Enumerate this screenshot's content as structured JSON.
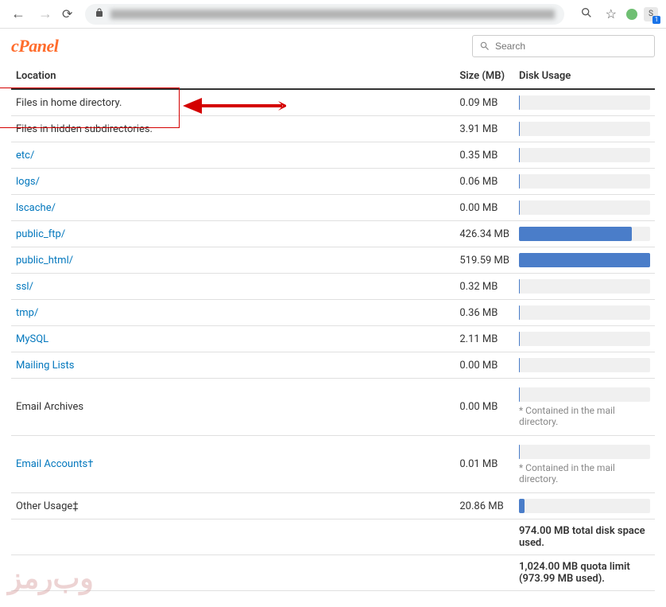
{
  "browser": {
    "ext_letter": "S"
  },
  "logo_text": "cPanel",
  "search": {
    "placeholder": "Search"
  },
  "table": {
    "headers": {
      "location": "Location",
      "size": "Size (MB)",
      "usage": "Disk Usage"
    },
    "rows": [
      {
        "label": "Files in home directory.",
        "link": false,
        "size": "0.09 MB",
        "bar": 0.5,
        "note": null
      },
      {
        "label": "Files in hidden subdirectories.",
        "link": false,
        "size": "3.91 MB",
        "bar": 0.5,
        "note": null
      },
      {
        "label": "etc/",
        "link": true,
        "size": "0.35 MB",
        "bar": 0.5,
        "note": null
      },
      {
        "label": "logs/",
        "link": true,
        "size": "0.06 MB",
        "bar": 0.5,
        "note": null
      },
      {
        "label": "lscache/",
        "link": true,
        "size": "0.00 MB",
        "bar": 0.5,
        "note": null
      },
      {
        "label": "public_ftp/",
        "link": true,
        "size": "426.34 MB",
        "bar": 86,
        "note": null
      },
      {
        "label": "public_html/",
        "link": true,
        "size": "519.59 MB",
        "bar": 100,
        "note": null
      },
      {
        "label": "ssl/",
        "link": true,
        "size": "0.32 MB",
        "bar": 0.5,
        "note": null
      },
      {
        "label": "tmp/",
        "link": true,
        "size": "0.36 MB",
        "bar": 0.5,
        "note": null
      },
      {
        "label": "MySQL",
        "link": true,
        "size": "2.11 MB",
        "bar": 0.5,
        "note": null
      },
      {
        "label": "Mailing Lists",
        "link": true,
        "size": "0.00 MB",
        "bar": 0.5,
        "note": null
      },
      {
        "label": "Email Archives",
        "link": false,
        "size": "0.00 MB",
        "bar": 0.5,
        "note": "* Contained in the mail directory.",
        "pad": true
      },
      {
        "label": "Email Accounts†",
        "link": true,
        "size": "0.01 MB",
        "bar": 0.5,
        "note": "* Contained in the mail directory.",
        "pad": true
      },
      {
        "label": "Other Usage‡",
        "link": false,
        "size": "20.86 MB",
        "bar": 4,
        "note": null
      }
    ],
    "summary": [
      "974.00 MB total disk space used.",
      "1,024.00 MB quota limit (973.99 MB used)."
    ]
  },
  "watermark": "وب‌رمز"
}
